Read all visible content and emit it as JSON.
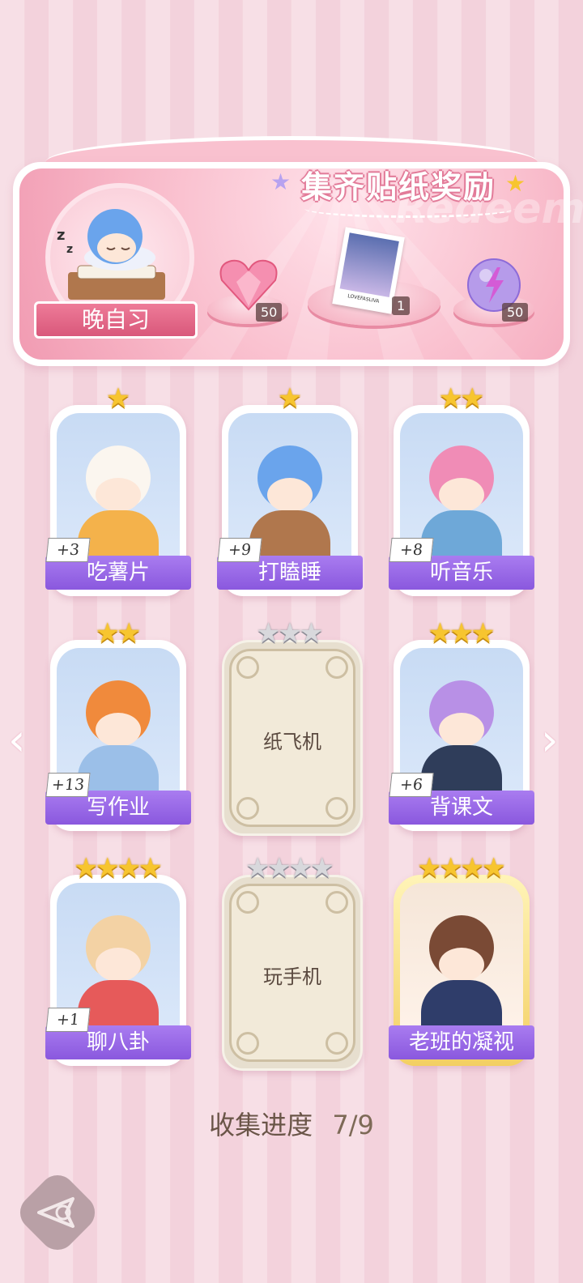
{
  "banner": {
    "title": "集齐贴纸奖励",
    "watermark": "Redeem",
    "level_label": "晚自习",
    "rewards": [
      {
        "icon": "heart-gem-icon",
        "count": "50"
      },
      {
        "icon": "photo-card-icon",
        "count": "1",
        "card_text": "LOVEFASLIVA"
      },
      {
        "icon": "lightning-orb-icon",
        "count": "50"
      }
    ]
  },
  "cards": [
    {
      "name": "吃薯片",
      "stars": 1,
      "max_stars": 1,
      "bonus": "+3",
      "locked": false,
      "art": "cat-eating-chips"
    },
    {
      "name": "打瞌睡",
      "stars": 1,
      "max_stars": 1,
      "bonus": "+9",
      "locked": false,
      "art": "boy-sleeping"
    },
    {
      "name": "听音乐",
      "stars": 2,
      "max_stars": 2,
      "bonus": "+8",
      "locked": false,
      "art": "girl-headphones"
    },
    {
      "name": "写作业",
      "stars": 2,
      "max_stars": 2,
      "bonus": "+13",
      "locked": false,
      "art": "boy-homework"
    },
    {
      "name": "纸飞机",
      "stars": 0,
      "max_stars": 3,
      "bonus": "",
      "locked": true
    },
    {
      "name": "背课文",
      "stars": 3,
      "max_stars": 3,
      "bonus": "+6",
      "locked": false,
      "art": "girl-reciting"
    },
    {
      "name": "聊八卦",
      "stars": 4,
      "max_stars": 4,
      "bonus": "+1",
      "locked": false,
      "art": "dog-watermelon"
    },
    {
      "name": "玩手机",
      "stars": 0,
      "max_stars": 4,
      "bonus": "",
      "locked": true
    },
    {
      "name": "老班的凝视",
      "stars": 4,
      "max_stars": 4,
      "bonus": "",
      "locked": false,
      "gold": true,
      "art": "teacher-glasses"
    }
  ],
  "progress": {
    "label": "收集进度",
    "value": "7/9"
  },
  "nav": {
    "prev": "‹",
    "next": "›"
  },
  "colors": {
    "name_bar": "#8a58de",
    "star": "#f7c52f",
    "banner": "#f19bb2"
  }
}
